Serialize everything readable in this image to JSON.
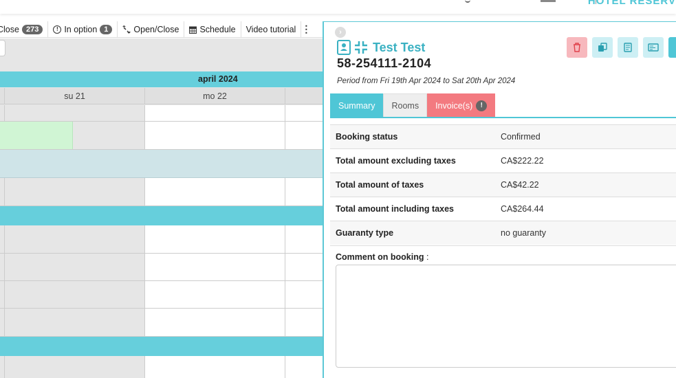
{
  "header": {
    "brand": "HOTEL RESERV"
  },
  "toolbar": {
    "close_label": "Close",
    "close_count": "273",
    "in_option_label": "In option",
    "in_option_count": "1",
    "open_close_label": "Open/Close",
    "schedule_label": "Schedule",
    "video_label": "Video tutorial"
  },
  "calendar": {
    "month": "april 2024",
    "days": [
      "su 21",
      "mo 22"
    ]
  },
  "booking": {
    "guest_name": "Test Test",
    "number": "58-254111-2104",
    "period": "Period from Fri 19th Apr 2024 to Sat 20th Apr 2024"
  },
  "tabs": {
    "summary": "Summary",
    "rooms": "Rooms",
    "invoices": "Invoice(s)",
    "invoice_warning": "!"
  },
  "summary_rows": [
    {
      "label": "Booking status",
      "value": "Confirmed"
    },
    {
      "label": "Total amount excluding taxes",
      "value": "CA$222.22"
    },
    {
      "label": "Total amount of taxes",
      "value": "CA$42.22"
    },
    {
      "label": "Total amount including taxes",
      "value": "CA$264.44"
    },
    {
      "label": "Guaranty type",
      "value": "no guaranty"
    }
  ],
  "comment": {
    "label": "Comment on booking",
    "suffix": " :",
    "value": ""
  },
  "actions": {
    "info_label": "i"
  },
  "colors": {
    "accent": "#4fc6d6",
    "danger": "#f37a80",
    "calendar_band": "#66cfdc"
  }
}
